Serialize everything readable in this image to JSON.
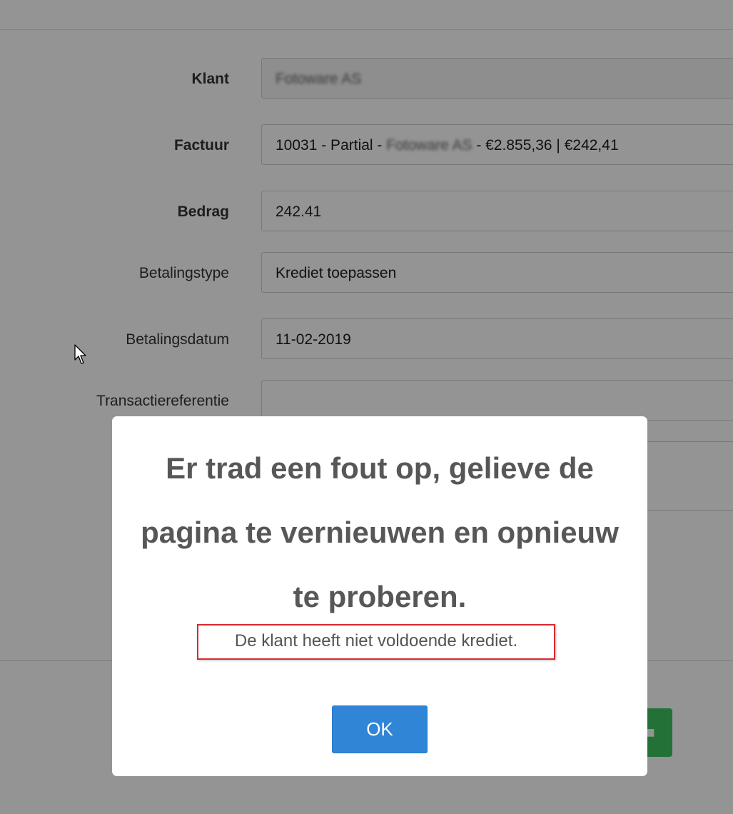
{
  "form": {
    "klant": {
      "label": "Klant",
      "value": "Fotoware AS"
    },
    "factuur": {
      "label": "Factuur",
      "value_prefix": "10031 - Partial",
      "value_sep1": " - ",
      "value_customer": "Fotoware AS",
      "value_sep2": " - ",
      "value_suffix": "€2.855,36 | €242,41"
    },
    "bedrag": {
      "label": "Bedrag",
      "value": "242.41"
    },
    "betalingstype": {
      "label": "Betalingstype",
      "value": "Krediet toepassen"
    },
    "betalingsdatum": {
      "label": "Betalingsdatum",
      "value": "11-02-2019"
    },
    "transactiereferentie": {
      "label": "Transactiereferentie",
      "value": ""
    }
  },
  "modal": {
    "title": "Er trad een fout op, gelieve de pagina te vernieuwen en opnieuw te proberen.",
    "message": "De klant heeft niet voldoende krediet.",
    "ok_label": "OK"
  },
  "colors": {
    "ok_button": "#3085d6",
    "message_border": "#d9272e",
    "save_button": "#3ec35f"
  }
}
